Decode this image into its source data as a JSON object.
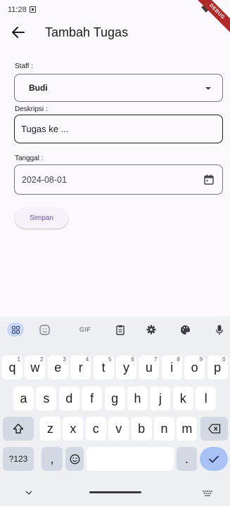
{
  "status": {
    "time": "11:28",
    "debug_label": "DEBUG"
  },
  "app_bar": {
    "title": "Tambah Tugas"
  },
  "form": {
    "staff_label": "Staff :",
    "staff_value": "Budi",
    "desc_label": "Deskripsi :",
    "desc_value": "Tugas ke ...",
    "date_label": "Tanggal :",
    "date_value": "2024-08-01",
    "save_label": "Simpan"
  },
  "keyboard": {
    "toolbar": [
      "apps-icon",
      "sticker-icon",
      "GIF",
      "clipboard-icon",
      "settings-icon",
      "palette-icon",
      "mic-icon"
    ],
    "gif_label": "GIF",
    "row1": [
      {
        "k": "q",
        "n": "1"
      },
      {
        "k": "w",
        "n": "2"
      },
      {
        "k": "e",
        "n": "3"
      },
      {
        "k": "r",
        "n": "4"
      },
      {
        "k": "t",
        "n": "5"
      },
      {
        "k": "y",
        "n": "6"
      },
      {
        "k": "u",
        "n": "7"
      },
      {
        "k": "i",
        "n": "8"
      },
      {
        "k": "o",
        "n": "9"
      },
      {
        "k": "p",
        "n": "0"
      }
    ],
    "row2": [
      "a",
      "s",
      "d",
      "f",
      "g",
      "h",
      "j",
      "k",
      "l"
    ],
    "row3": [
      "z",
      "x",
      "c",
      "v",
      "b",
      "n",
      "m"
    ],
    "sym_label": "?123",
    "comma": ",",
    "period": "."
  },
  "colors": {
    "accent": "#6750a4",
    "keyboard_bg": "#eef0f4",
    "enter_key": "#a8c2f5",
    "apps_pill": "#c9d7f5",
    "debug_ribbon": "#b02a2a"
  }
}
